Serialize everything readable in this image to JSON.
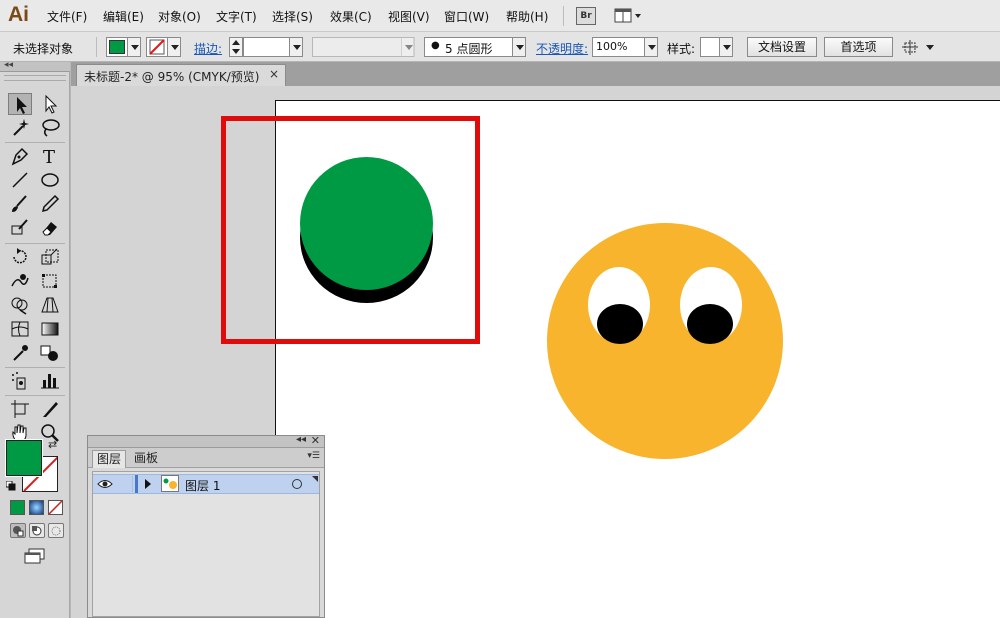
{
  "app": {
    "logo": "Ai"
  },
  "menu": {
    "items": [
      "文件(F)",
      "编辑(E)",
      "对象(O)",
      "文字(T)",
      "选择(S)",
      "效果(C)",
      "视图(V)",
      "窗口(W)",
      "帮助(H)"
    ],
    "bridge_label": "Br"
  },
  "control_bar": {
    "selection_status": "未选择对象",
    "stroke_label": "描边:",
    "brush_size_label": "5 点圆形",
    "opacity_label": "不透明度:",
    "opacity_value": "100%",
    "style_label": "样式:",
    "document_setup_button": "文档设置",
    "preferences_button": "首选项",
    "colors": {
      "fill": "#009a44",
      "stroke_slash": "#e01a1a"
    }
  },
  "document": {
    "tab_title": "未标题-2* @ 95% (CMYK/预览)",
    "close_symbol": "×"
  },
  "artwork": {
    "highlight_color": "#e00b0b",
    "green_circle_color": "#009a44",
    "shadow_color": "#000000",
    "smiley_color": "#f7b42c"
  },
  "tools": {
    "fill_color": "#009a44",
    "items": [
      "selection-tool",
      "direct-selection-tool",
      "magic-wand-tool",
      "lasso-tool",
      "pen-tool",
      "type-tool",
      "line-segment-tool",
      "ellipse-tool",
      "paintbrush-tool",
      "pencil-tool",
      "blob-brush-tool",
      "eraser-tool",
      "rotate-tool",
      "scale-tool",
      "warp-tool",
      "free-transform-tool",
      "shape-builder-tool",
      "perspective-grid-tool",
      "mesh-tool",
      "gradient-tool",
      "eyedropper-tool",
      "blend-tool",
      "symbol-sprayer-tool",
      "column-graph-tool",
      "artboard-tool",
      "slice-tool",
      "hand-tool",
      "zoom-tool"
    ]
  },
  "layers_panel": {
    "collapse_symbol": "◂◂",
    "close_symbol": "✕",
    "tabs": [
      {
        "label": "图层",
        "active": true
      },
      {
        "label": "画板",
        "active": false
      }
    ],
    "layers": [
      {
        "name": "图层 1",
        "selected": true
      }
    ]
  }
}
